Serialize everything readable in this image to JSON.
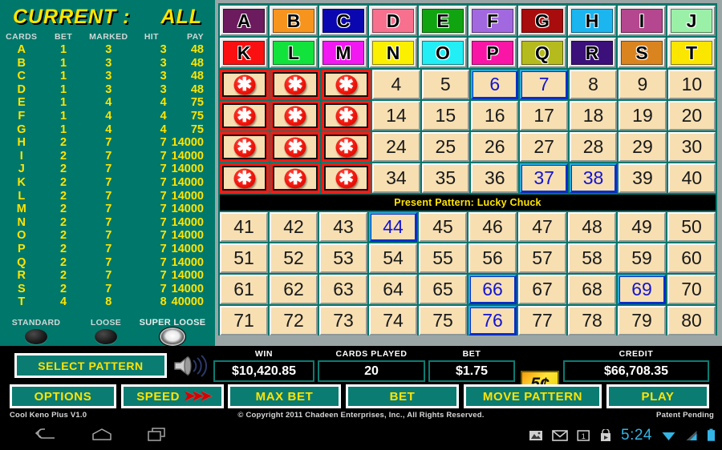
{
  "sidebar": {
    "title_current": "CURRENT :",
    "title_all": "ALL",
    "headers": [
      "CARDS",
      "BET",
      "MARKED",
      "HIT",
      "PAY"
    ],
    "rows": [
      {
        "card": "A",
        "bet": "1",
        "marked": "3",
        "hit": "3",
        "pay": "48"
      },
      {
        "card": "B",
        "bet": "1",
        "marked": "3",
        "hit": "3",
        "pay": "48"
      },
      {
        "card": "C",
        "bet": "1",
        "marked": "3",
        "hit": "3",
        "pay": "48"
      },
      {
        "card": "D",
        "bet": "1",
        "marked": "3",
        "hit": "3",
        "pay": "48"
      },
      {
        "card": "E",
        "bet": "1",
        "marked": "4",
        "hit": "4",
        "pay": "75"
      },
      {
        "card": "F",
        "bet": "1",
        "marked": "4",
        "hit": "4",
        "pay": "75"
      },
      {
        "card": "G",
        "bet": "1",
        "marked": "4",
        "hit": "4",
        "pay": "75"
      },
      {
        "card": "H",
        "bet": "2",
        "marked": "7",
        "hit": "7",
        "pay": "14000"
      },
      {
        "card": "I",
        "bet": "2",
        "marked": "7",
        "hit": "7",
        "pay": "14000"
      },
      {
        "card": "J",
        "bet": "2",
        "marked": "7",
        "hit": "7",
        "pay": "14000"
      },
      {
        "card": "K",
        "bet": "2",
        "marked": "7",
        "hit": "7",
        "pay": "14000"
      },
      {
        "card": "L",
        "bet": "2",
        "marked": "7",
        "hit": "7",
        "pay": "14000"
      },
      {
        "card": "M",
        "bet": "2",
        "marked": "7",
        "hit": "7",
        "pay": "14000"
      },
      {
        "card": "N",
        "bet": "2",
        "marked": "7",
        "hit": "7",
        "pay": "14000"
      },
      {
        "card": "O",
        "bet": "2",
        "marked": "7",
        "hit": "7",
        "pay": "14000"
      },
      {
        "card": "P",
        "bet": "2",
        "marked": "7",
        "hit": "7",
        "pay": "14000"
      },
      {
        "card": "Q",
        "bet": "2",
        "marked": "7",
        "hit": "7",
        "pay": "14000"
      },
      {
        "card": "R",
        "bet": "2",
        "marked": "7",
        "hit": "7",
        "pay": "14000"
      },
      {
        "card": "S",
        "bet": "2",
        "marked": "7",
        "hit": "7",
        "pay": "14000"
      },
      {
        "card": "T",
        "bet": "4",
        "marked": "8",
        "hit": "8",
        "pay": "40000"
      }
    ],
    "modes": [
      {
        "label": "STANDARD",
        "selected": false
      },
      {
        "label": "LOOSE",
        "selected": false
      },
      {
        "label": "SUPER LOOSE",
        "selected": true
      }
    ]
  },
  "board": {
    "letter_buttons": [
      {
        "label": "A",
        "color": "#6b1b5e"
      },
      {
        "label": "B",
        "color": "#f7941d"
      },
      {
        "label": "C",
        "color": "#0b07b0"
      },
      {
        "label": "D",
        "color": "#f7718f"
      },
      {
        "label": "E",
        "color": "#11a411"
      },
      {
        "label": "F",
        "color": "#a268df"
      },
      {
        "label": "G",
        "color": "#a80c0c"
      },
      {
        "label": "H",
        "color": "#1bb6f0"
      },
      {
        "label": "I",
        "color": "#b4478f"
      },
      {
        "label": "J",
        "color": "#9bf0a8"
      },
      {
        "label": "K",
        "color": "#fa1010"
      },
      {
        "label": "L",
        "color": "#12e23c"
      },
      {
        "label": "M",
        "color": "#f118f1"
      },
      {
        "label": "N",
        "color": "#fbf000"
      },
      {
        "label": "O",
        "color": "#22eef5"
      },
      {
        "label": "P",
        "color": "#f916a6"
      },
      {
        "label": "Q",
        "color": "#b5bb1c"
      },
      {
        "label": "R",
        "color": "#3b107a"
      },
      {
        "label": "S",
        "color": "#da8420"
      },
      {
        "label": "T",
        "color": "#fbe600"
      }
    ],
    "pattern_text": "Present Pattern: Lucky Chuck",
    "mark_glyph": "✱",
    "marked_numbers": [
      1,
      2,
      3,
      11,
      12,
      13,
      21,
      22,
      23,
      31,
      32,
      33
    ],
    "hit_numbers": [
      6,
      7,
      37,
      38,
      44,
      66,
      69,
      76
    ],
    "upper_rows": [
      [
        1,
        2,
        3,
        4,
        5,
        6,
        7,
        8,
        9,
        10
      ],
      [
        11,
        12,
        13,
        14,
        15,
        16,
        17,
        18,
        19,
        20
      ],
      [
        21,
        22,
        23,
        24,
        25,
        26,
        27,
        28,
        29,
        30
      ],
      [
        31,
        32,
        33,
        34,
        35,
        36,
        37,
        38,
        39,
        40
      ]
    ],
    "lower_rows": [
      [
        41,
        42,
        43,
        44,
        45,
        46,
        47,
        48,
        49,
        50
      ],
      [
        51,
        52,
        53,
        54,
        55,
        56,
        57,
        58,
        59,
        60
      ],
      [
        61,
        62,
        63,
        64,
        65,
        66,
        67,
        68,
        69,
        70
      ],
      [
        71,
        72,
        73,
        74,
        75,
        76,
        77,
        78,
        79,
        80
      ]
    ]
  },
  "panel": {
    "select_pattern": "SELECT PATTERN",
    "options": "OPTIONS",
    "speed": "SPEED",
    "max_bet": "MAX BET",
    "bet_button": "BET",
    "move_pattern": "MOVE PATTERN",
    "play": "PLAY",
    "coin_denomination": "5¢",
    "meters": [
      {
        "label": "WIN",
        "value": "$10,420.85"
      },
      {
        "label": "CARDS PLAYED",
        "value": "20"
      },
      {
        "label": "BET",
        "value": "$1.75"
      },
      {
        "label": "CREDIT",
        "value": "$66,708.35"
      }
    ]
  },
  "footer": {
    "version": "Cool Keno Plus V1.0",
    "copyright": "© Copyright 2011 Chadeen Enterprises, Inc., All Rights Reserved.",
    "patent": "Patent Pending"
  },
  "navbar": {
    "clock": "5:24"
  }
}
